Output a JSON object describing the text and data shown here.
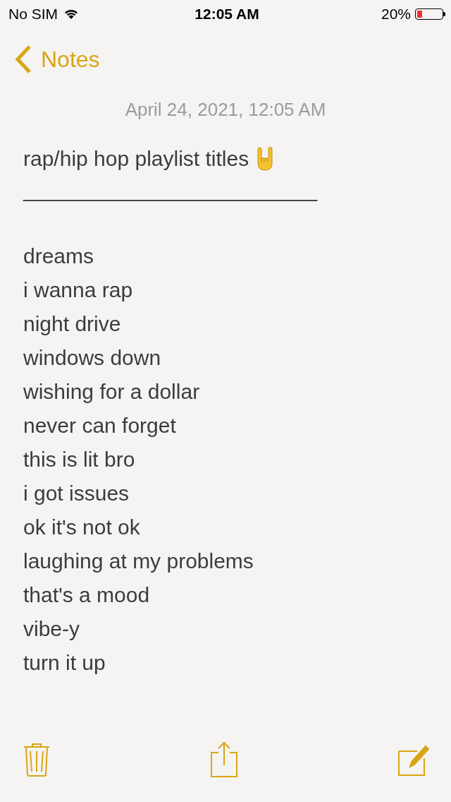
{
  "status_bar": {
    "carrier": "No SIM",
    "time": "12:05 AM",
    "battery_percent": "20%",
    "battery": {
      "level": 0.2
    }
  },
  "nav": {
    "back_label": "Notes"
  },
  "note": {
    "date": "April 24, 2021, 12:05 AM",
    "title": "rap/hip hop playlist titles",
    "divider": "_________________________",
    "lines": [
      "dreams",
      "i wanna rap",
      "night drive",
      "windows down",
      "wishing for a dollar",
      "never can forget",
      "this is lit bro",
      "i got issues",
      "ok it's not ok",
      "laughing at my problems",
      "that's a mood",
      "vibe-y",
      "turn it up"
    ]
  }
}
